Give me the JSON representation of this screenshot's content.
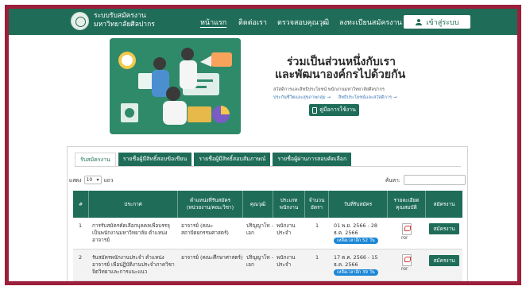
{
  "header": {
    "brand_line1": "ระบบรับสมัครงาน",
    "brand_line2": "มหาวิทยาลัยศิลปากร",
    "menu": [
      "หน้าแรก",
      "ติดต่อเรา",
      "ตรวจสอบคุณวุฒิ",
      "ลงทะเบียนสมัครงาน"
    ],
    "login_label": "เข้าสู่ระบบ"
  },
  "hero": {
    "title_line1": "ร่วมเป็นส่วนหนึ่งกับเรา",
    "title_line2": "และพัฒนาองค์กรไปด้วยกัน",
    "description": "สวัสดิการและสิทธิประโยชน์ พนักงานมหาวิทยาลัยศิลปากร",
    "link1": "ประกันชีวิตและสุขภาพกลุ่ม →",
    "link2": "สิทธิประโยชน์และสวัสดิการ →",
    "manual_label": "คู่มือการใช้งาน"
  },
  "tabs": [
    "รับสมัครงาน",
    "รายชื่อผู้มีสิทธิ์สอบข้อเขียน",
    "รายชื่อผู้มีสิทธิ์สอบสัมภาษณ์",
    "รายชื่อผู้ผ่านการสอบคัดเลือก"
  ],
  "table_controls": {
    "show_prefix": "แสดง",
    "show_value": "10",
    "show_suffix": "แถว",
    "search_label": "ค้นหา:"
  },
  "columns": [
    "#",
    "ประกาศ",
    "ตำแหน่งที่รับสมัคร (หน่วยงาน/คณะวิชา)",
    "คุณวุฒิ",
    "ประเภทพนักงาน",
    "จำนวนอัตรา",
    "วันที่รับสมัคร",
    "รายละเอียดคุณสมบัติ",
    "สมัครงาน"
  ],
  "rows": [
    {
      "no": "1",
      "announce": "การรับสมัครคัดเลือกบุคคลเพื่อบรรจุเป็นพนักงานมหาวิทยาลัย ตำแหน่งอาจารย์",
      "position": "อาจารย์ (คณะสถาปัตยกรรมศาสตร์)",
      "qualification": "ปริญญาโท - เอก",
      "type": "พนักงานประจำ",
      "count": "1",
      "date": "01 พ.ย. 2566 - 28 ธ.ค. 2566",
      "remaining": "เหลือเวลาอีก 52 วัน",
      "pdf": "PDF",
      "apply": "สมัครงาน"
    },
    {
      "no": "2",
      "announce": "รับสมัครพนักงานประจำ ตำแหน่งอาจารย์ เพื่อปฏิบัติงานประจำภาควิชาจิตวิทยาและการแนะแนว",
      "position": "อาจารย์ (คณะศึกษาศาสตร์)",
      "qualification": "ปริญญาโท - เอก",
      "type": "พนักงานประจำ",
      "count": "1",
      "date": "17 ต.ค. 2566 - 15 ธ.ค. 2566",
      "remaining": "เหลือเวลาอีก 39 วัน",
      "pdf": "PDF",
      "apply": "สมัครงาน"
    }
  ]
}
